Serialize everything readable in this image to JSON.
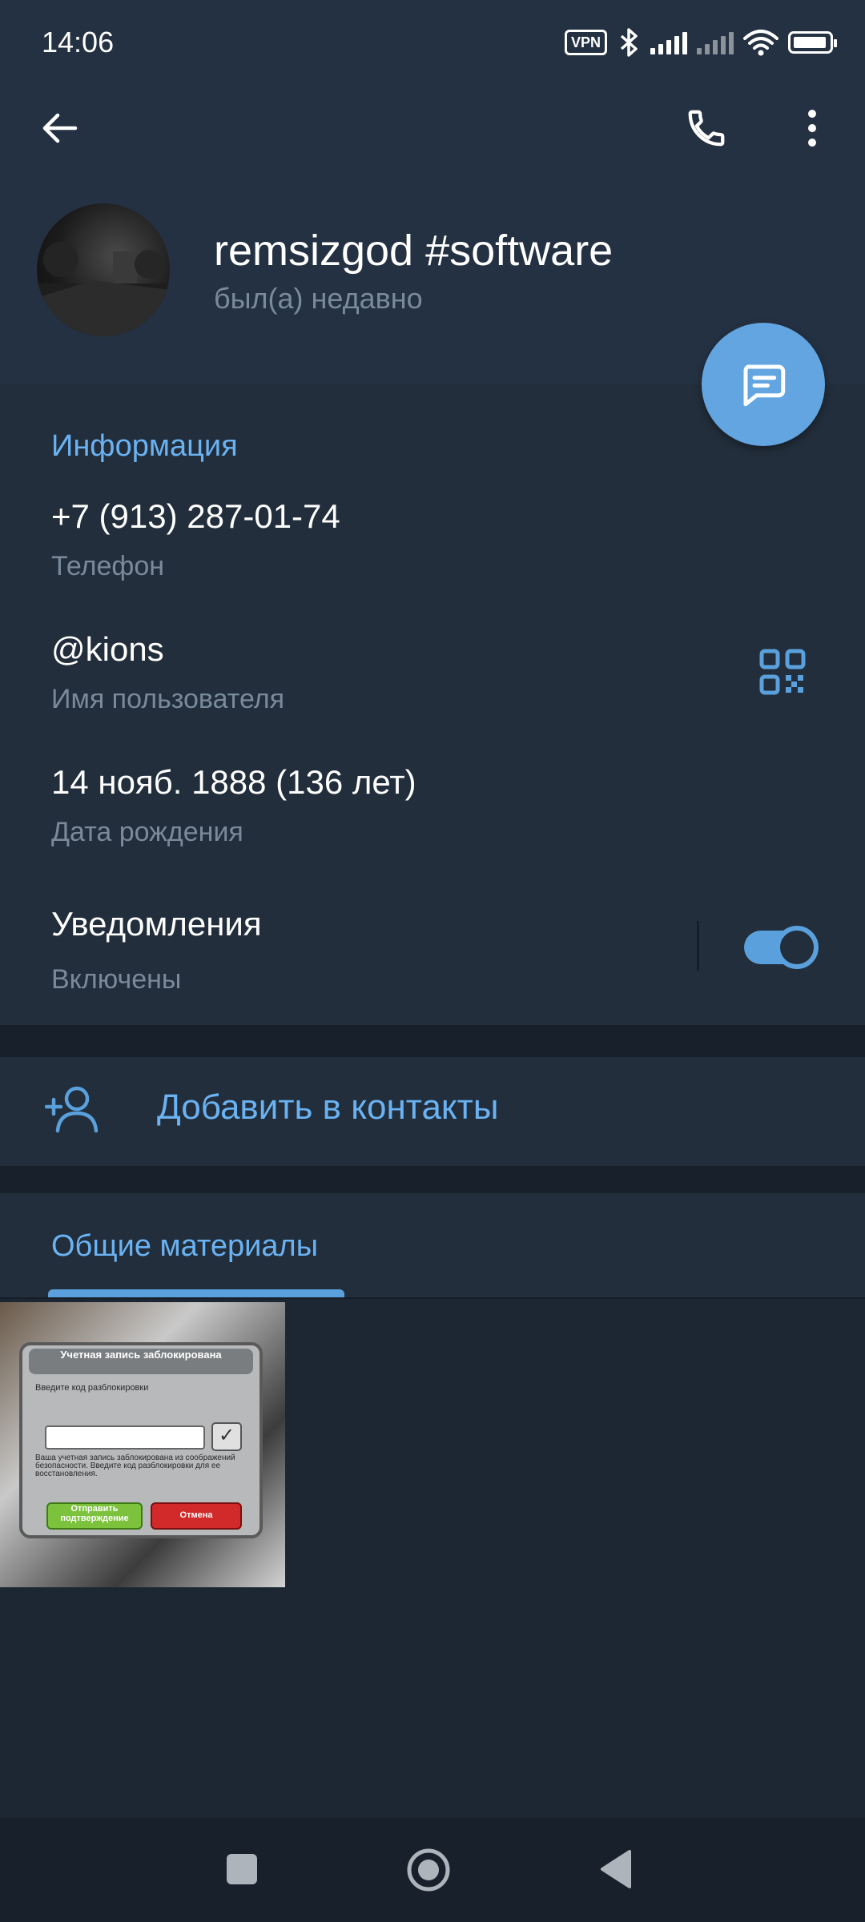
{
  "status_bar": {
    "time": "14:06",
    "icons": [
      "vpn-badge",
      "bluetooth-icon",
      "signal-icon",
      "signal-icon",
      "wifi-icon",
      "battery-icon"
    ],
    "vpn_label": "VPN"
  },
  "top_bar": {
    "back_icon": "arrow-left-icon",
    "call_icon": "phone-icon",
    "menu_icon": "more-vertical-icon"
  },
  "profile": {
    "name": "remsizgod #software",
    "status": "был(а) недавно",
    "fab_icon": "message-icon"
  },
  "info": {
    "section_title": "Информация",
    "phone_value": "+7 (913) 287-01-74",
    "phone_label": "Телефон",
    "username_value": "@kions",
    "username_label": "Имя пользователя",
    "birthday_value": "14 нояб. 1888 (136 лет)",
    "birthday_label": "Дата рождения",
    "notifications_title": "Уведомления",
    "notifications_state": "Включены",
    "notifications_enabled": true,
    "accent_color": "#6ab2f2"
  },
  "actions": {
    "add_contact_label": "Добавить в контакты",
    "add_contact_icon": "add-user-icon"
  },
  "shared": {
    "tab_label": "Общие материалы",
    "media": [
      {
        "dialog_title": "Учетная запись заблокирована",
        "dialog_prompt": "Введите код разблокировки",
        "dialog_body": "Ваша учетная запись заблокирована из соображений безопасности. Введите код разблокировки для ее восстановления.",
        "btn_primary": "Отправить подтверждение",
        "btn_cancel": "Отмена"
      }
    ]
  },
  "nav_bar": {
    "icons": [
      "recents-square-icon",
      "home-circle-icon",
      "back-triangle-icon"
    ]
  },
  "colors": {
    "header_bg": "#243142",
    "section_bg": "#222e3b",
    "separator_bg": "#18212b",
    "secondary_text": "#7a8a9b",
    "fab_bg": "#62a5e1"
  }
}
